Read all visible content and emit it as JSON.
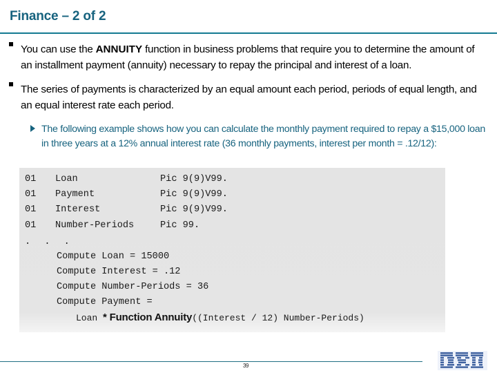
{
  "slide": {
    "title": "Finance – 2 of 2",
    "page_number": "39",
    "accent_color": "#17637f",
    "rule_color": "#137a91",
    "code_bg_color": "#e5e5e5",
    "logo_name": "ibm-logo",
    "logo_text": "IBM"
  },
  "bullets": [
    {
      "marker": "square-bullet",
      "text_before": "You can use the ",
      "emphasis": "ANNUITY",
      "text_after": " function in business problems that require you to determine the amount of an installment payment (annuity) necessary to repay the principal and interest of a loan."
    },
    {
      "marker": "square-bullet",
      "text": "The series of payments is characterized by an equal amount each period, periods of equal length, and an equal interest rate each period."
    }
  ],
  "subbullet": {
    "marker": "triangle-bullet",
    "text": "The following example shows how you can calculate the monthly payment required to repay a $15,000 loan in three years at a 12% annual interest rate (36 monthly payments, interest per month = .12/12):"
  },
  "code": {
    "declarations": [
      {
        "level": "01",
        "name": "Loan",
        "picture": "Pic 9(9)V99."
      },
      {
        "level": "01",
        "name": "Payment",
        "picture": "Pic 9(9)V99."
      },
      {
        "level": "01",
        "name": "Interest",
        "picture": "Pic 9(9)V99."
      },
      {
        "level": "01",
        "name": "Number-Periods",
        "picture": "Pic 99."
      }
    ],
    "ellipsis": ". . .",
    "statements": [
      "Compute Loan = 15000",
      "Compute Interest = .12",
      "Compute Number-Periods = 36",
      "Compute Payment ="
    ],
    "final_expression": {
      "operand": "Loan ",
      "function_call": "* Function Annuity",
      "arguments": "((Interest / 12) Number-Periods)"
    }
  }
}
